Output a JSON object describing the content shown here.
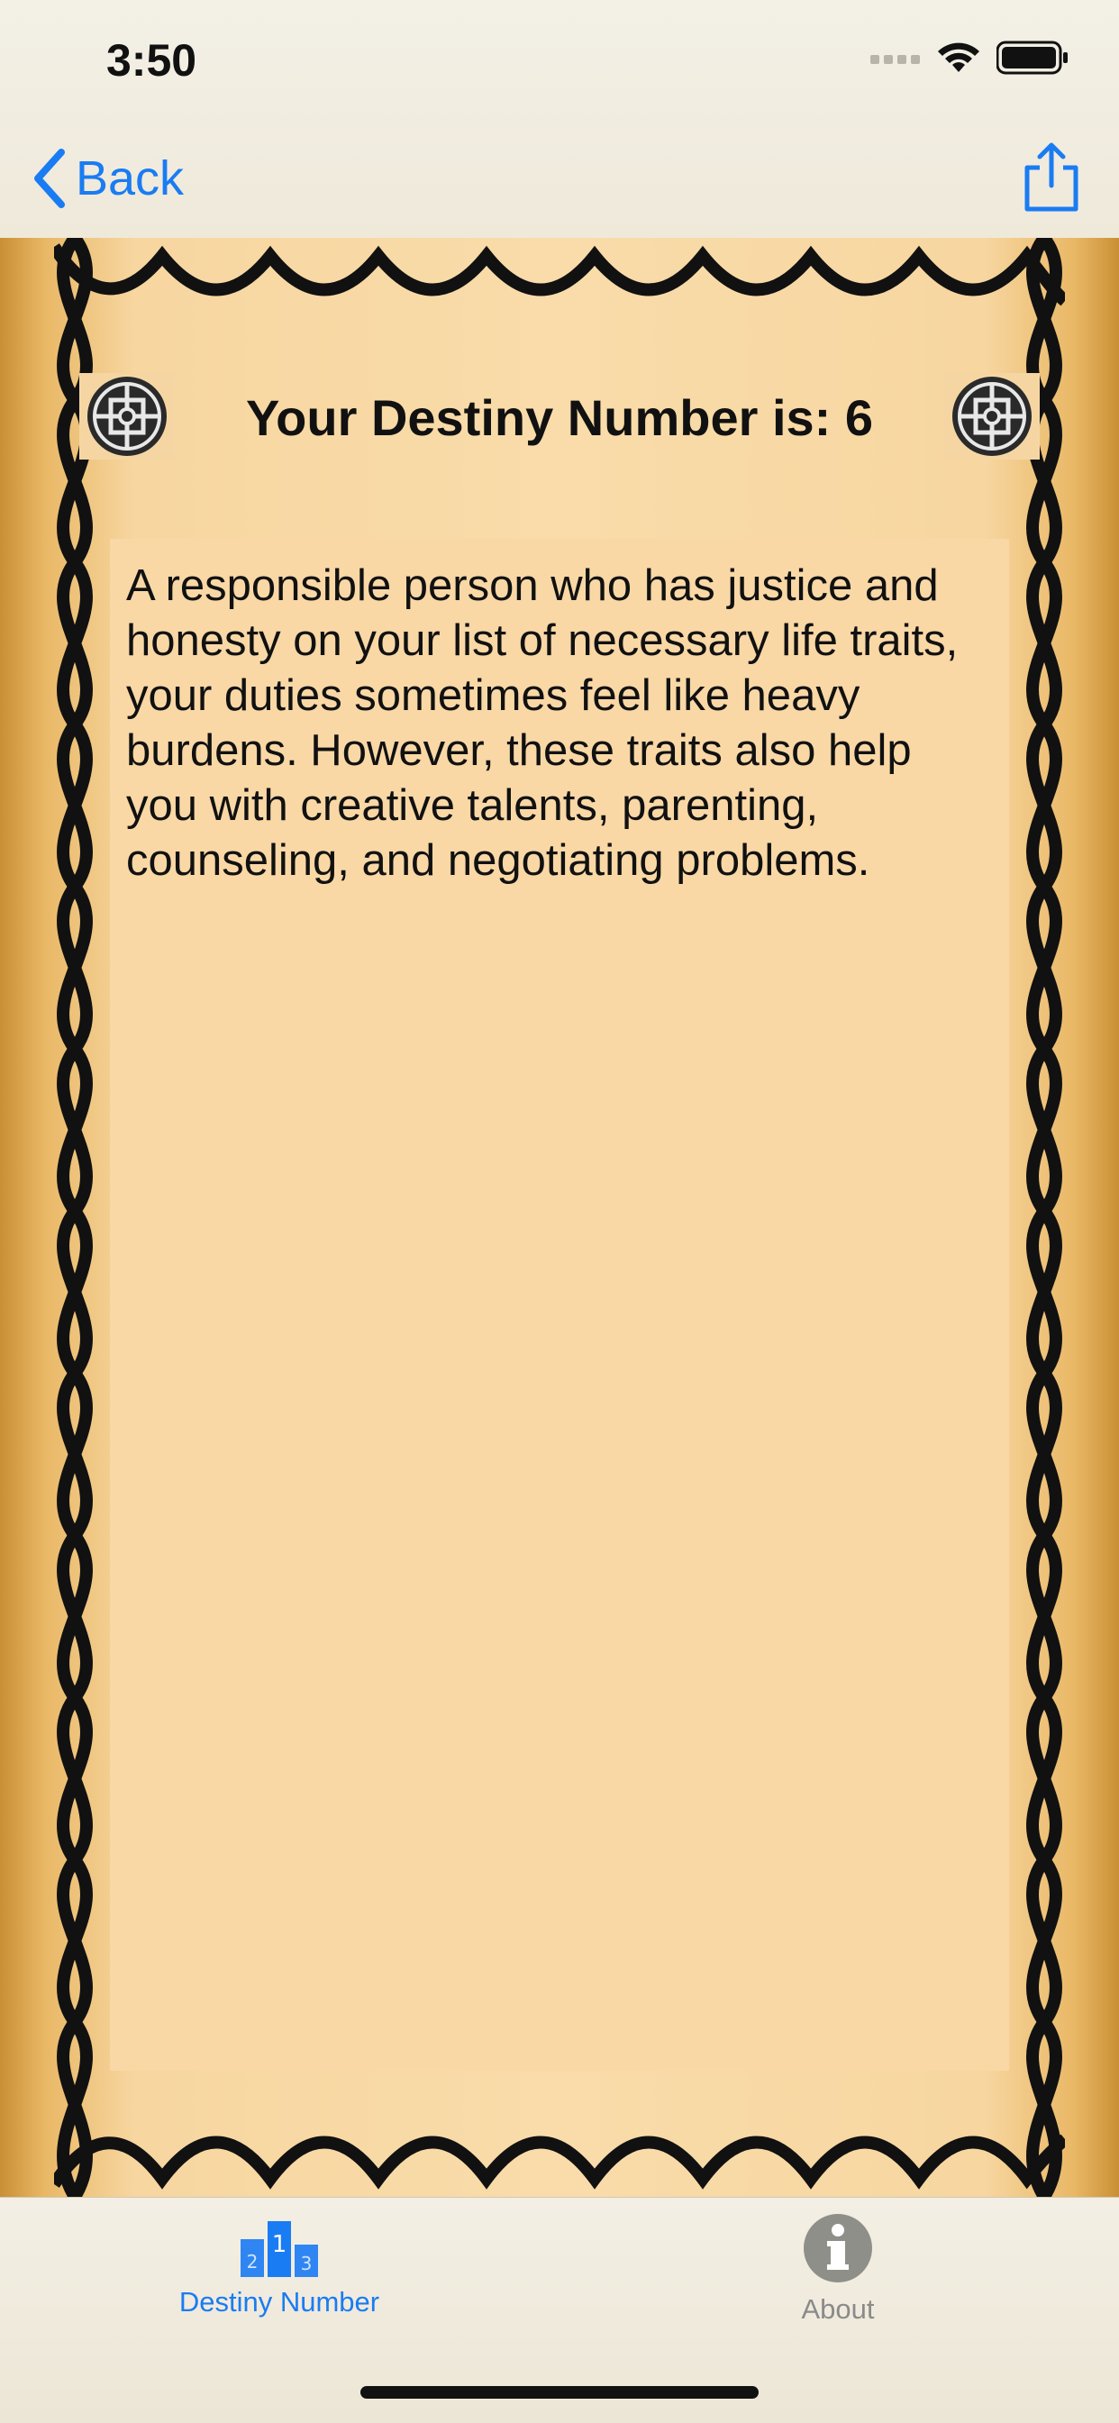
{
  "status_bar": {
    "time": "3:50"
  },
  "nav": {
    "back_label": "Back",
    "share_icon": "share-icon",
    "accent_color": "#1a7cf2"
  },
  "content": {
    "title": "Your Destiny Number is: 6",
    "description": "A responsible person who has justice and honesty on your list of necessary life traits, your duties sometimes feel like heavy burdens. However, these traits also help you with creative talents, parenting, counseling, and negotiating problems."
  },
  "tabs": [
    {
      "label": "Destiny Number",
      "icon": "podium-icon",
      "active": true
    },
    {
      "label": "About",
      "icon": "info-icon",
      "active": false
    }
  ]
}
